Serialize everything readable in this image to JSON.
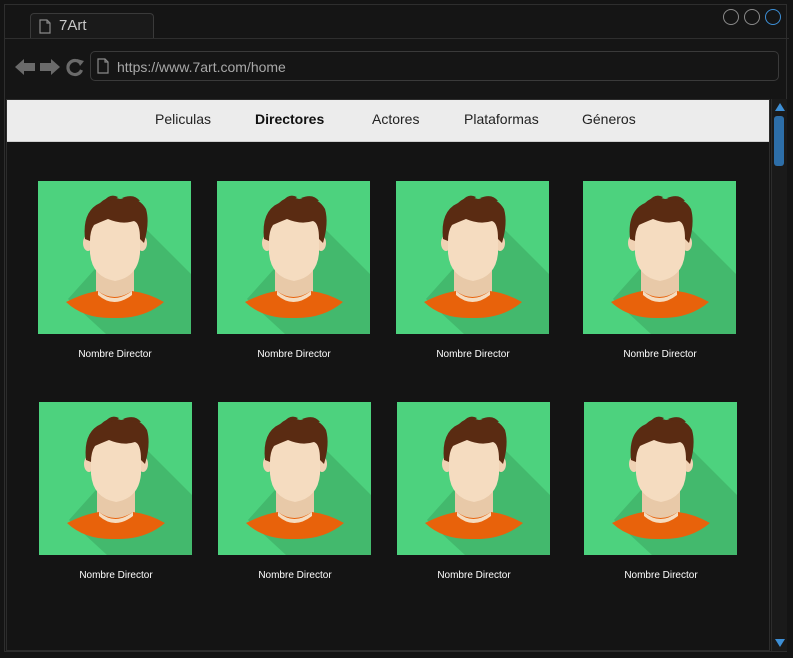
{
  "browser": {
    "tab_title": "7Art",
    "url": "https://www.7art.com/home"
  },
  "menu": {
    "items": [
      {
        "label": "Peliculas",
        "active": false
      },
      {
        "label": "Directores",
        "active": true
      },
      {
        "label": "Actores",
        "active": false
      },
      {
        "label": "Plataformas",
        "active": false
      },
      {
        "label": "Géneros",
        "active": false
      }
    ]
  },
  "directors": [
    {
      "name": "Nombre Director"
    },
    {
      "name": "Nombre Director"
    },
    {
      "name": "Nombre Director"
    },
    {
      "name": "Nombre Director"
    },
    {
      "name": "Nombre Director"
    },
    {
      "name": "Nombre Director"
    },
    {
      "name": "Nombre Director"
    },
    {
      "name": "Nombre Director"
    }
  ],
  "colors": {
    "avatar_bg": "#4dd27e",
    "avatar_shadow": "#43b96d",
    "hair": "#5a2b12",
    "skin": "#f5dcc0",
    "neck_shadow": "#e8c9a8",
    "shirt": "#e8620b",
    "accent": "#3d8fd6"
  }
}
